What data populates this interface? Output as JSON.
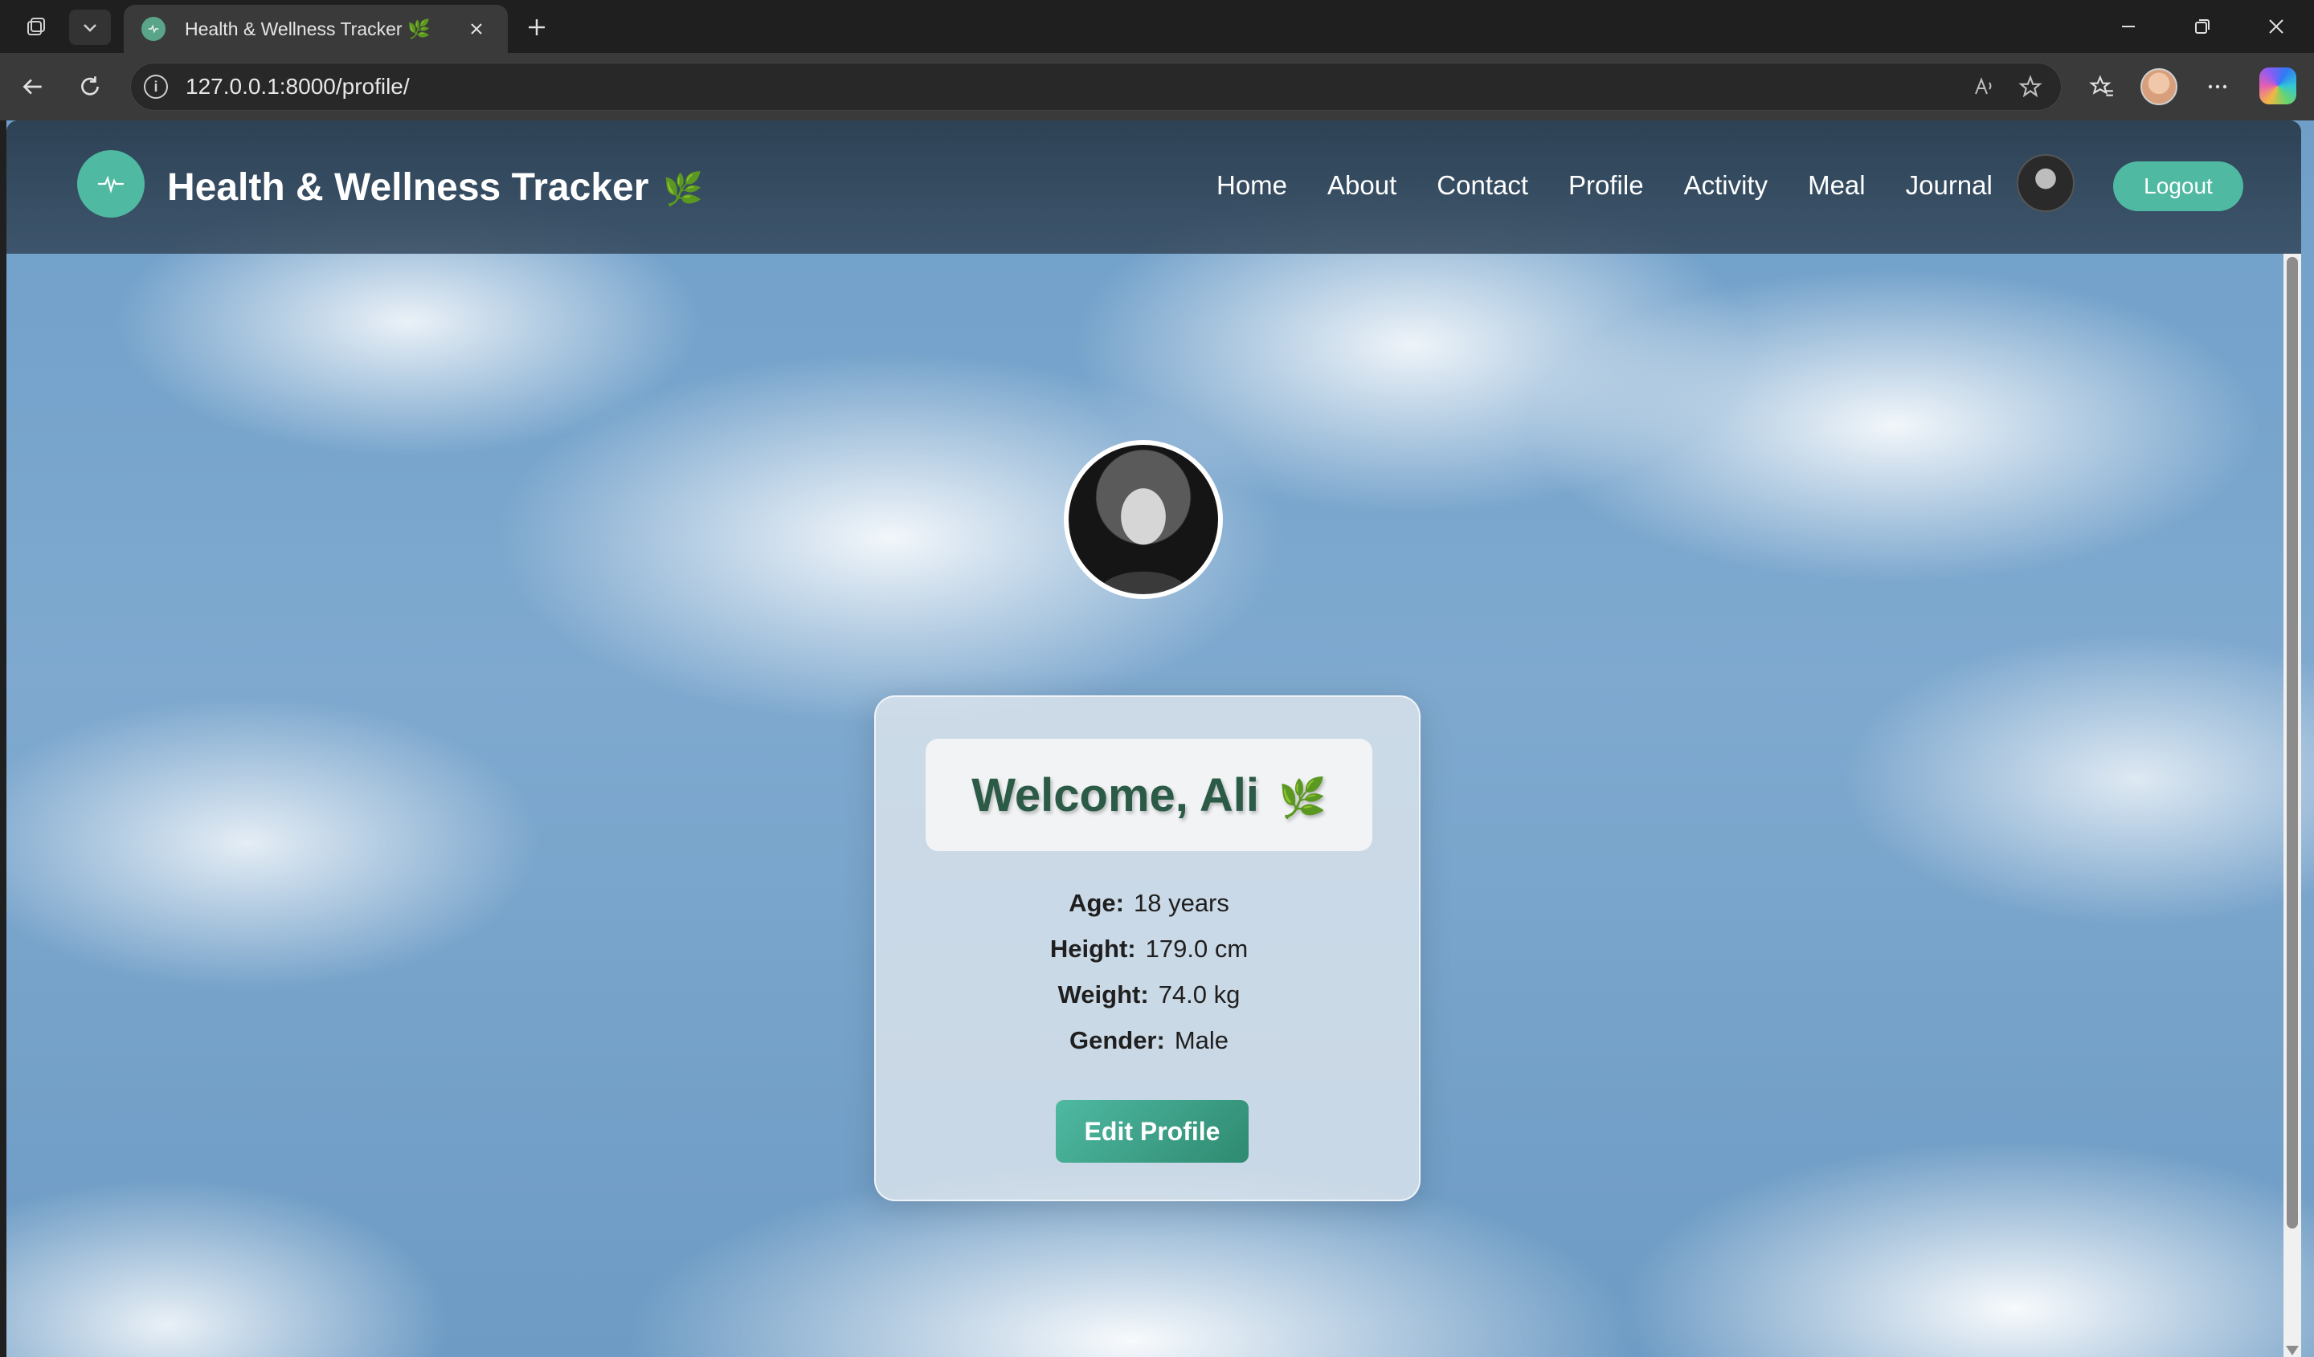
{
  "browser": {
    "tab_title": "Health & Wellness Tracker 🌿",
    "url": "127.0.0.1:8000/profile/"
  },
  "navbar": {
    "brand": "Health & Wellness Tracker",
    "brand_icon": "🌿",
    "links": [
      "Home",
      "About",
      "Contact",
      "Profile",
      "Activity",
      "Meal",
      "Journal"
    ],
    "logout_label": "Logout"
  },
  "profile": {
    "welcome": "Welcome, Ali",
    "welcome_icon": "🌿",
    "stats": [
      {
        "label": "Age:",
        "value": "18 years"
      },
      {
        "label": "Height:",
        "value": "179.0 cm"
      },
      {
        "label": "Weight:",
        "value": "74.0 kg"
      },
      {
        "label": "Gender:",
        "value": "Male"
      }
    ],
    "edit_label": "Edit Profile"
  },
  "colors": {
    "accent": "#4fb9a2",
    "welcome_text": "#2b5a46",
    "navbar_bg": "#2c3e50"
  },
  "icons": [
    "tab-actions-icon",
    "tab-list-icon",
    "favicon-icon",
    "close-icon",
    "plus-icon",
    "minimize-icon",
    "restore-icon",
    "window-close-icon",
    "back-icon",
    "reload-icon",
    "info-icon",
    "read-aloud-icon",
    "favorite-star-icon",
    "favorites-icon",
    "more-icon",
    "copilot-icon",
    "pulse-icon",
    "leaf-icon"
  ]
}
